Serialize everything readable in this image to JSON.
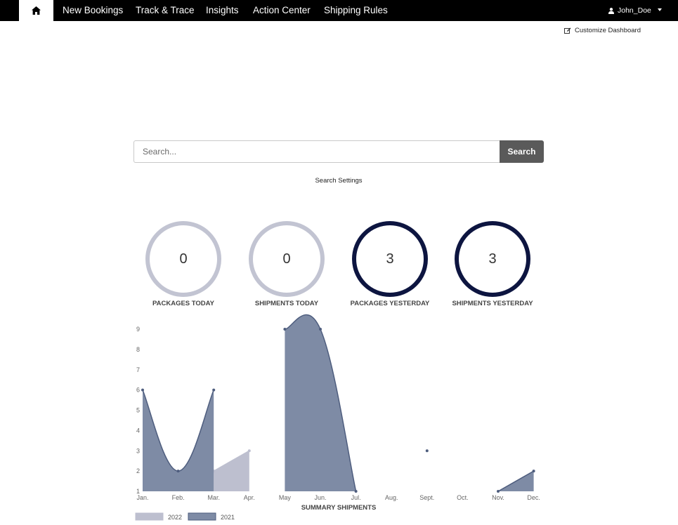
{
  "nav": {
    "home_icon": "home-icon",
    "items": [
      "New Bookings",
      "Track & Trace",
      "Insights",
      "Action Center",
      "Shipping Rules"
    ],
    "user": "John_Doe",
    "user_icon": "user-icon"
  },
  "customize": {
    "label": "Customize Dashboard",
    "icon": "edit-icon"
  },
  "search": {
    "placeholder": "Search...",
    "button_label": "Search",
    "settings_label": "Search Settings"
  },
  "stats": [
    {
      "value": "0",
      "label": "PACKAGES TODAY",
      "style": "light"
    },
    {
      "value": "0",
      "label": "SHIPMENTS TODAY",
      "style": "light"
    },
    {
      "value": "3",
      "label": "PACKAGES YESTERDAY",
      "style": "dark"
    },
    {
      "value": "3",
      "label": "SHIPMENTS YESTERDAY",
      "style": "dark"
    }
  ],
  "colors": {
    "ring_light": "#c2c4d2",
    "ring_dark": "#0d1540",
    "series_2022": "#bdbfcf",
    "series_2021": "#7e8ba5",
    "line_2021": "#4e5d7e"
  },
  "chart_data": {
    "type": "area",
    "title": "SUMMARY SHIPMENTS",
    "categories": [
      "Jan.",
      "Feb.",
      "Mar.",
      "Apr.",
      "May",
      "Jun.",
      "Jul.",
      "Aug.",
      "Sept.",
      "Oct.",
      "Nov.",
      "Dec."
    ],
    "yticks": [
      1,
      2,
      3,
      4,
      5,
      6,
      7,
      8,
      9
    ],
    "ylim": [
      1,
      9
    ],
    "legend_position": "bottom-left",
    "series": [
      {
        "name": "2022",
        "values": [
          null,
          null,
          2,
          3,
          null,
          null,
          null,
          null,
          null,
          null,
          null,
          null
        ]
      },
      {
        "name": "2021",
        "values": [
          6,
          2,
          6,
          null,
          9,
          9,
          1,
          null,
          3,
          null,
          1,
          2
        ]
      }
    ]
  }
}
